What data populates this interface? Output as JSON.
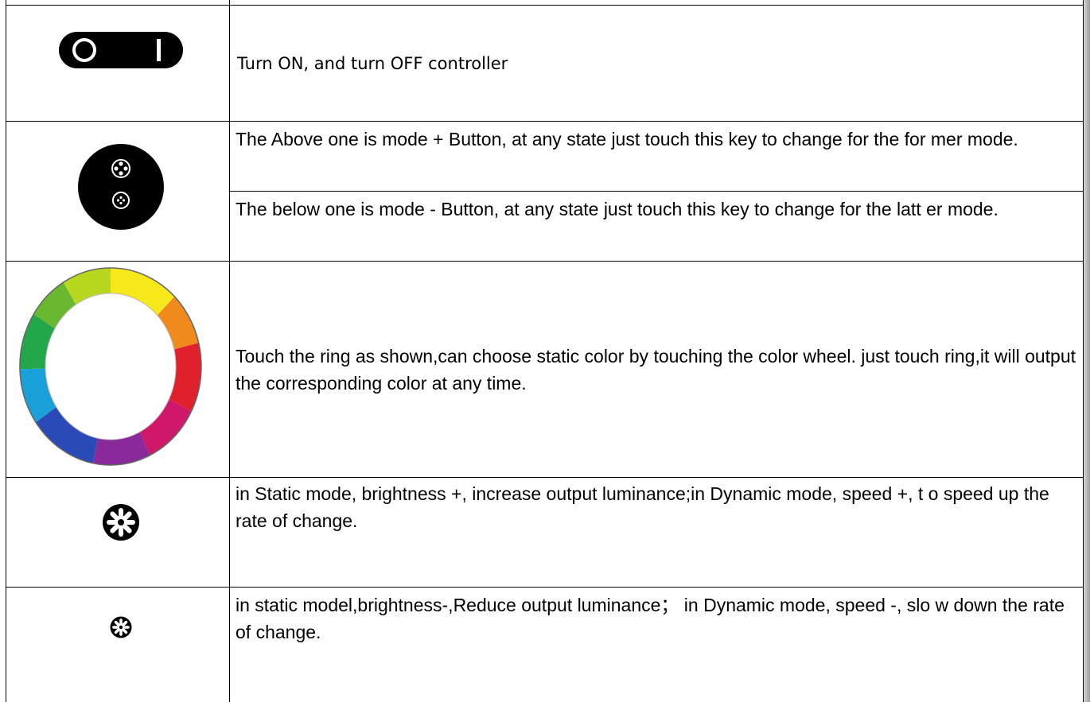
{
  "rows": [
    {
      "icon": "power-switch-icon",
      "text": "Turn ON, and turn OFF controller"
    },
    {
      "icon": "mode-buttons-icon",
      "text_upper": "The Above one is mode + Button, at any state just touch this key to change for the for mer mode.",
      "text_lower": "The below one is mode - Button, at any state just touch this key to change for the latt er mode."
    },
    {
      "icon": "color-wheel-icon",
      "text": "Touch the ring as shown,can choose static color by touching the color wheel. just touch ring,it will output the corresponding color at any time."
    },
    {
      "icon": "brightness-up-icon",
      "text": "in Static mode, brightness +, increase output luminance;in Dynamic mode, speed +, t o speed up the rate of change."
    },
    {
      "icon": "brightness-down-icon",
      "text": "in static model,brightness-,Reduce output luminance； in Dynamic mode, speed -, slo w down the rate of change."
    }
  ],
  "colors": {
    "border": "#000000",
    "icon_fill": "#000000"
  }
}
